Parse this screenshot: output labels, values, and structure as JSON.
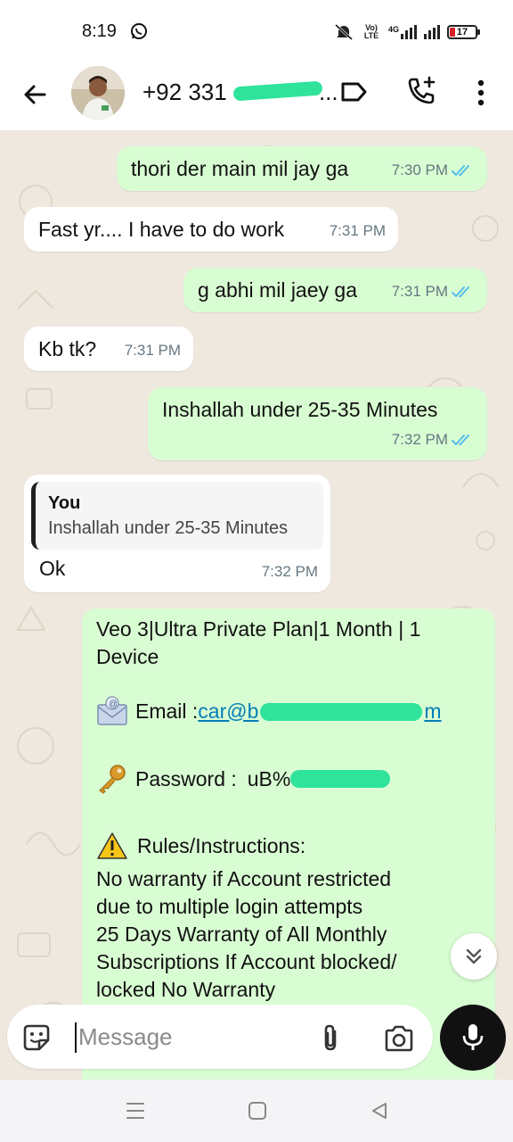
{
  "status_bar": {
    "time": "8:19",
    "network_label": "Vo) LTE",
    "network_type": "4G",
    "battery": "17",
    "icons": [
      "whatsapp-icon",
      "mute-icon",
      "signal-icon",
      "battery-icon"
    ]
  },
  "header": {
    "contact_name": "+92 331 ",
    "contact_name_suffix": "...",
    "icons": [
      "back-arrow-icon",
      "label-icon",
      "add-call-icon",
      "more-vert-icon"
    ]
  },
  "messages": [
    {
      "text": "thori der main mil jay ga",
      "time": "7:30 PM",
      "direction": "out",
      "read": true
    },
    {
      "text": "Fast yr.... I have to do work",
      "time": "7:31 PM",
      "direction": "in"
    },
    {
      "text": "g abhi mil jaey ga",
      "time": "7:31 PM",
      "direction": "out",
      "read": true
    },
    {
      "text": "Kb tk?",
      "time": "7:31 PM",
      "direction": "in"
    },
    {
      "text": "Inshallah under 25-35 Minutes",
      "time": "7:32 PM",
      "direction": "out",
      "read": true
    },
    {
      "text": "Ok",
      "time": "7:32 PM",
      "direction": "in",
      "quote": {
        "author": "You",
        "text": "Inshallah under 25-35 Minutes"
      }
    }
  ],
  "account_message": {
    "title": "Veo 3|Ultra Private Plan|1 Month | 1 Device",
    "email_label": "Email : ",
    "email_value": "car@b",
    "email_suffix": "m",
    "password_label": "Password : ",
    "password_value": "uB%",
    "rules_title": "Rules/Instructions:",
    "rules_lines": [
      "No warranty if Account restricted",
      "due to multiple login attempts",
      "25 Days Warranty of All Monthly",
      "Subscriptions If Account blocked/",
      "locked No Warranty"
    ],
    "icons": [
      "envelope-icon",
      "key-icon",
      "warning-icon"
    ]
  },
  "composer": {
    "placeholder": "Message",
    "icons": [
      "sticker-icon",
      "attach-icon",
      "camera-icon",
      "mic-icon"
    ]
  },
  "colors": {
    "outgoing_bubble": "#d9fdd3",
    "incoming_bubble": "#ffffff",
    "chat_background": "#efe8df",
    "read_ticks": "#53bdeb",
    "link": "#027eb5"
  }
}
